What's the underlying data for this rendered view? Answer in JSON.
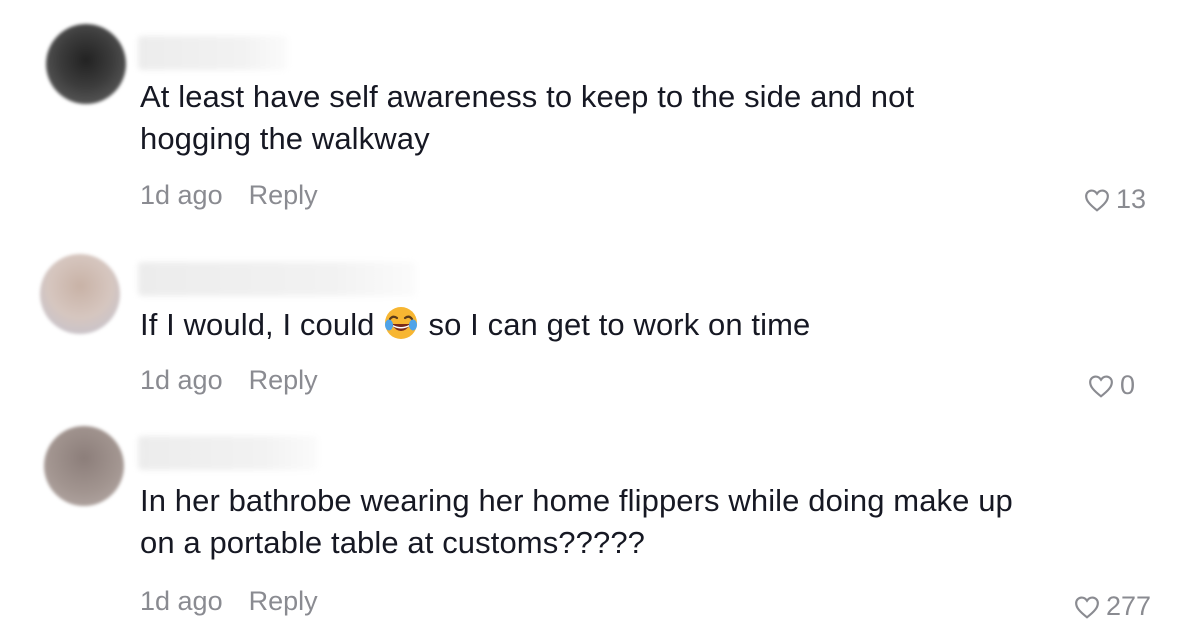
{
  "comments": [
    {
      "text": "At least have self awareness to keep to the side and not hogging the walkway",
      "age": "1d ago",
      "reply_label": "Reply",
      "likes": "13",
      "avatar_color": "#3a3a3a"
    },
    {
      "text_before": "If I would, I could",
      "emoji": "face-with-tears-of-joy",
      "text_after": "so I can get to work on time",
      "age": "1d ago",
      "reply_label": "Reply",
      "likes": "0",
      "avatar_color": "#c4b4ac"
    },
    {
      "text": "In her bathrobe wearing her home flippers while doing make up on a portable table at customs?????",
      "age": "1d ago",
      "reply_label": "Reply",
      "likes": "277",
      "avatar_color": "#9a8c88"
    }
  ],
  "icons": {
    "like": "heart-outline-icon"
  },
  "colors": {
    "primary_text": "#161823",
    "secondary_text": "#8a8b91"
  }
}
